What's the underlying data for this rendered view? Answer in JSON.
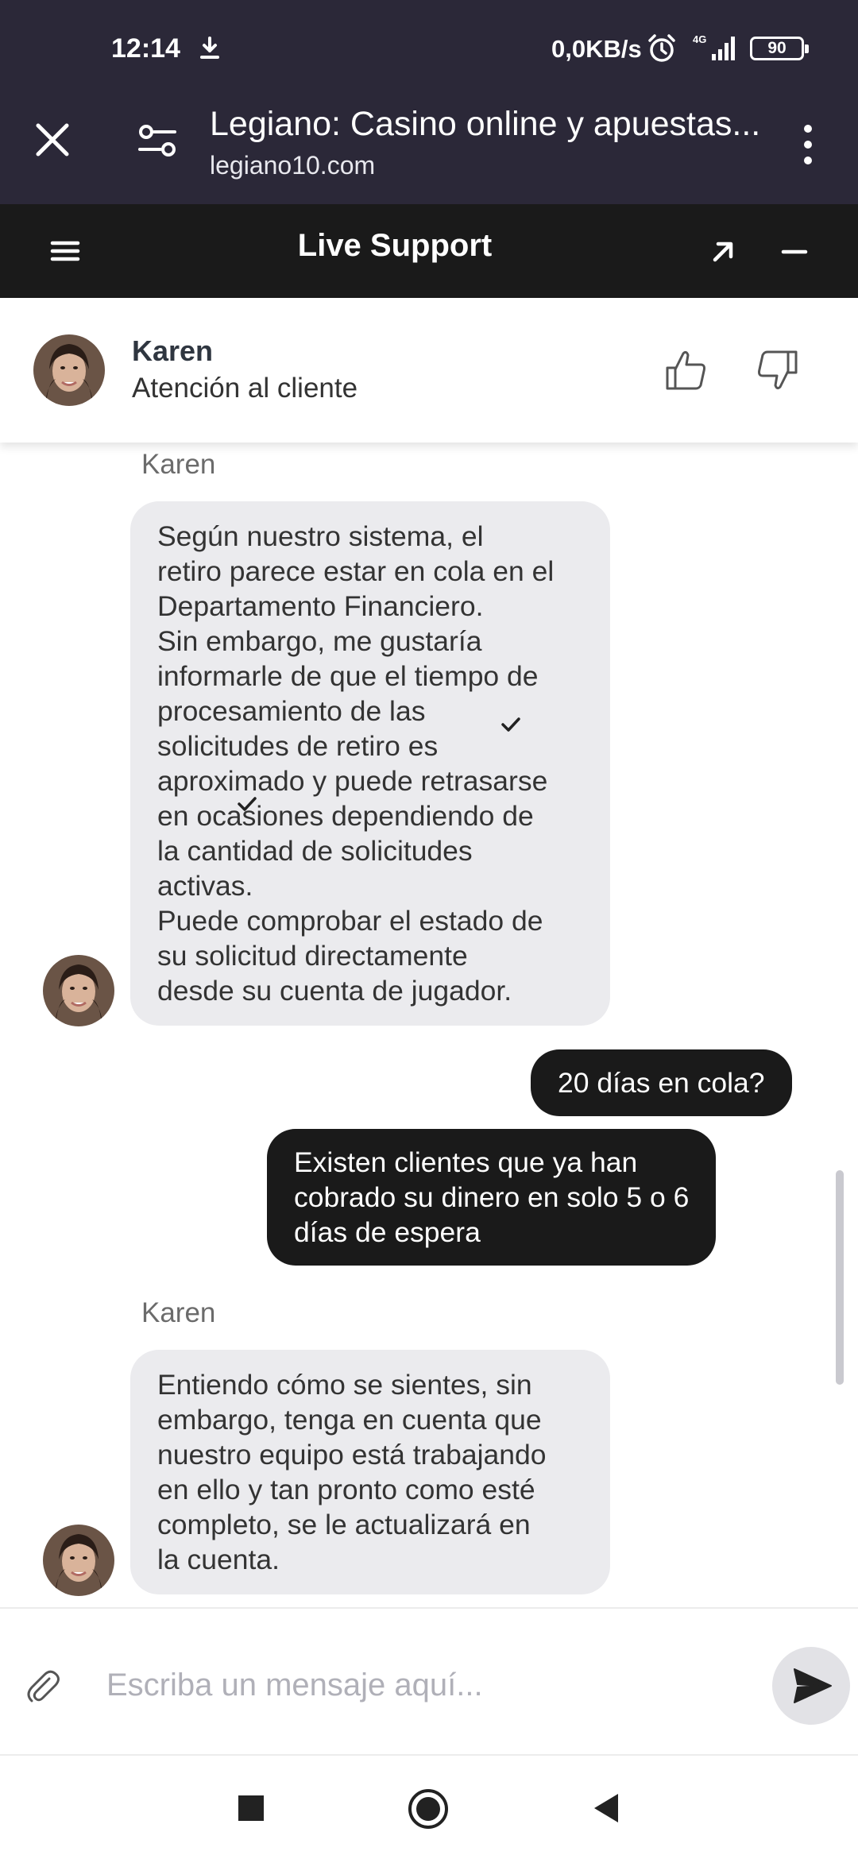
{
  "status_bar": {
    "time": "12:14",
    "network_speed": "0,0KB/s",
    "signal_label": "4G",
    "battery": "90"
  },
  "browser": {
    "title": "Legiano: Casino online y apuestas...",
    "url": "legiano10.com"
  },
  "support_header": {
    "title": "Live Support"
  },
  "agent": {
    "name": "Karen",
    "role": "Atención al cliente"
  },
  "messages": [
    {
      "direction": "incoming",
      "sender": "Karen",
      "lines": [
        "Según nuestro sistema, el",
        "retiro parece estar en cola en el",
        "Departamento Financiero.",
        "Sin embargo, me gustaría",
        "informarle de que el tiempo de",
        "procesamiento de las",
        "solicitudes de retiro es",
        "aproximado y puede retrasarse",
        "en ocasiones dependiendo de",
        "la cantidad de solicitudes",
        "activas.",
        "Puede comprobar el estado de",
        "su solicitud directamente",
        "desde su cuenta de jugador."
      ]
    },
    {
      "direction": "outgoing",
      "lines": [
        "20 días en cola?"
      ]
    },
    {
      "direction": "outgoing",
      "lines": [
        "Existen clientes que ya han",
        "cobrado su dinero en solo 5 o 6",
        "días de espera"
      ]
    },
    {
      "direction": "incoming",
      "sender": "Karen",
      "lines": [
        "Entiendo cómo se sientes, sin",
        "embargo, tenga en cuenta que",
        "nuestro equipo está trabajando",
        "en ello y tan pronto como esté",
        "completo, se le actualizará en",
        "la cuenta."
      ]
    }
  ],
  "composer": {
    "placeholder": "Escriba un mensaje aquí..."
  },
  "icons": {
    "download": "download-icon",
    "alarm": "alarm-icon",
    "signal": "signal-icon",
    "close": "close-icon",
    "site_settings": "tune-icon",
    "more": "more-vert-icon",
    "menu": "menu-icon",
    "expand": "arrow-expand-icon",
    "minimize": "minimize-icon",
    "like": "thumbs-up-icon",
    "dislike": "thumbs-down-icon",
    "attach": "paperclip-icon",
    "send": "send-icon"
  },
  "colors": {
    "status_bar_bg": "#2b2838",
    "support_header_bg": "#1a1a1a",
    "incoming_bubble": "#ebebee",
    "outgoing_bubble": "#1a1a1a"
  }
}
